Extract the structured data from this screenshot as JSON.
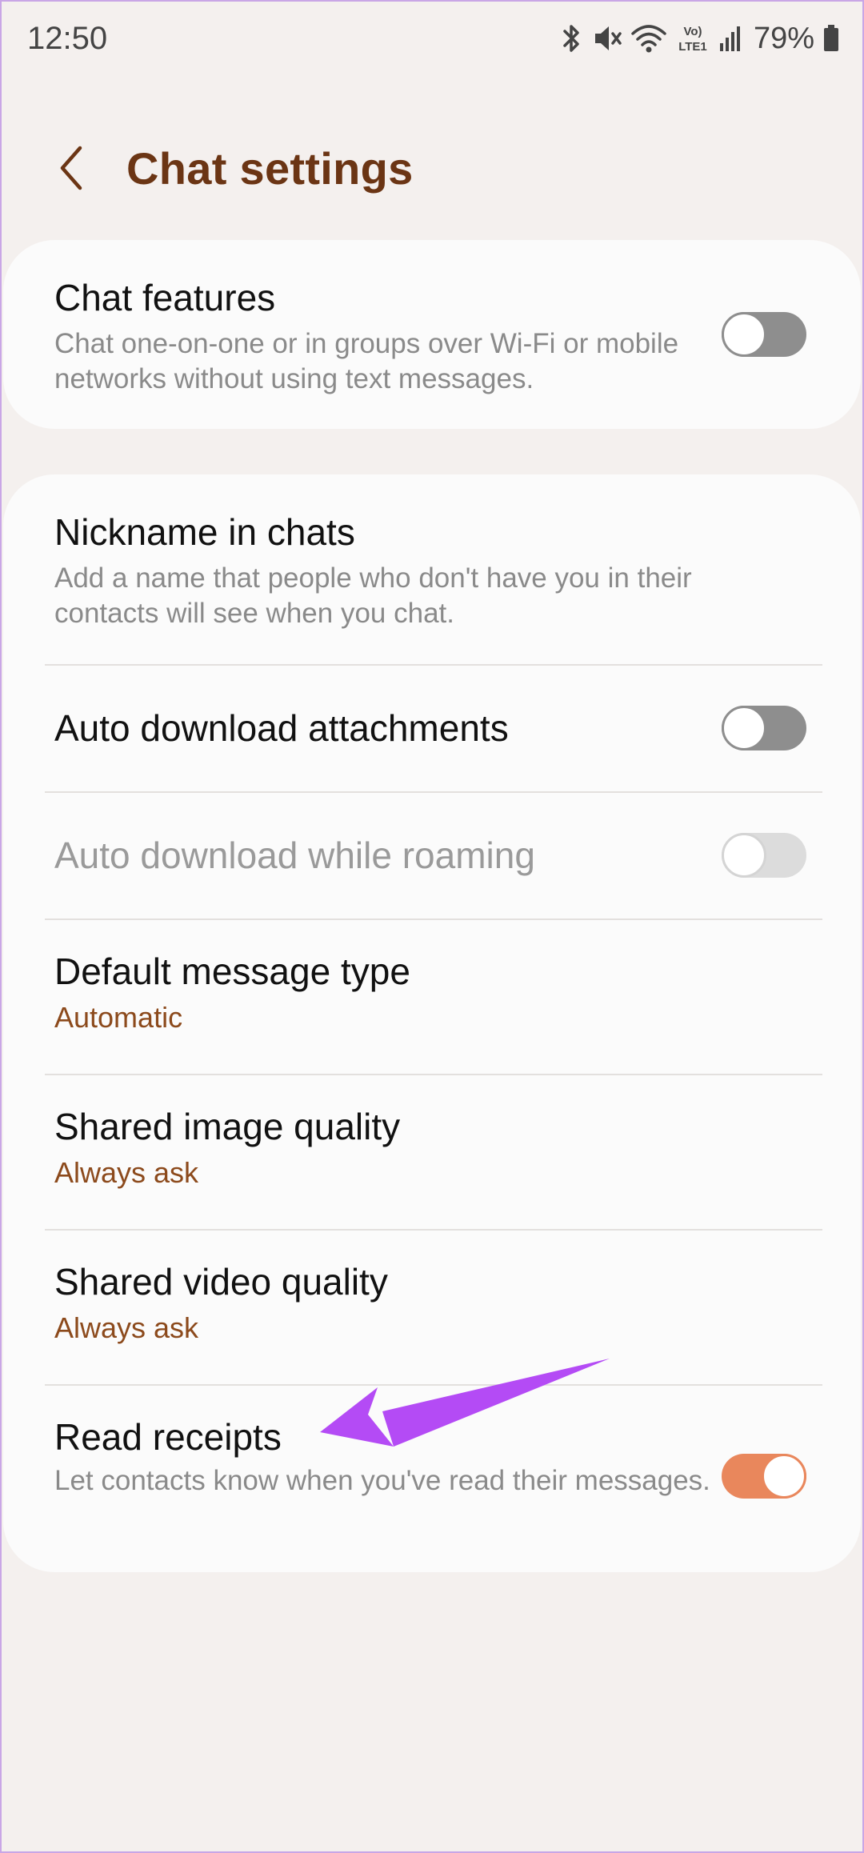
{
  "status_bar": {
    "time": "12:50",
    "battery_percent": "79%",
    "icons": [
      "bluetooth-icon",
      "mute-icon",
      "wifi-icon",
      "volte-icon",
      "signal-icon",
      "battery-icon"
    ],
    "volte_label_top": "Vo)",
    "volte_label_bottom": "LTE1"
  },
  "header": {
    "back_icon": "chevron-left-icon",
    "title": "Chat settings"
  },
  "colors": {
    "background": "#f4f0ee",
    "card": "#fbfbfb",
    "title": "#6b3514",
    "value": "#8c4a1c",
    "toggle_on": "#e9875c",
    "toggle_off": "#8e8e8e",
    "annotation_arrow": "#b44bf5"
  },
  "card_chat_features": {
    "title": "Chat features",
    "subtitle": "Chat one-on-one or in groups over Wi-Fi or mobile networks without using text messages.",
    "toggle_state": "off"
  },
  "card_settings": {
    "nickname": {
      "title": "Nickname in chats",
      "subtitle": "Add a name that people who don't have you in their contacts will see when you chat."
    },
    "auto_download": {
      "title": "Auto download attachments",
      "toggle_state": "off"
    },
    "auto_download_roaming": {
      "title": "Auto download while roaming",
      "toggle_state": "off",
      "disabled": true
    },
    "default_message_type": {
      "title": "Default message type",
      "value": "Automatic"
    },
    "shared_image_quality": {
      "title": "Shared image quality",
      "value": "Always ask"
    },
    "shared_video_quality": {
      "title": "Shared video quality",
      "value": "Always ask"
    },
    "read_receipts": {
      "title": "Read receipts",
      "subtitle": "Let contacts know when you've read their messages.",
      "toggle_state": "on"
    }
  },
  "annotation": {
    "icon": "arrow-pointer-icon"
  }
}
